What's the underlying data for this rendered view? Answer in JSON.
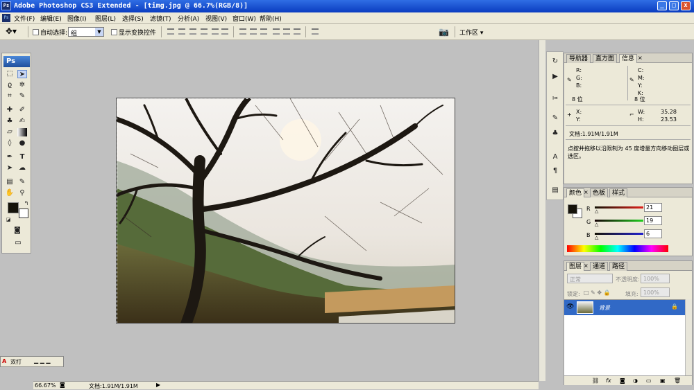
{
  "window": {
    "app_icon": "Ps",
    "title": "Adobe Photoshop CS3 Extended - [timg.jpg @ 66.7%(RGB/8)]",
    "minimize": "_",
    "maximize": "□",
    "close": "x"
  },
  "menu": {
    "items": [
      "文件(F)",
      "编辑(E)",
      "图像(I)",
      "图层(L)",
      "选择(S)",
      "滤镜(T)",
      "分析(A)",
      "视图(V)",
      "窗口(W)",
      "帮助(H)"
    ]
  },
  "options": {
    "auto_select_label": "自动选择:",
    "auto_select_value": "组",
    "show_transform_label": "显示变换控件",
    "workspace_label": "工作区"
  },
  "toolbox": {
    "logo": "Ps"
  },
  "status": {
    "zoom": "66.67%",
    "doc": "文档:1.91M/1.91M"
  },
  "info_panel": {
    "tabs": [
      "导航器",
      "直方图",
      "信息"
    ],
    "rgb": [
      "R:",
      "G:",
      "B:"
    ],
    "cmyk": [
      "C:",
      "M:",
      "Y:",
      "K:"
    ],
    "bit_left": "8 位",
    "bit_right": "8 位",
    "x_label": "X:",
    "y_label": "Y:",
    "w_label": "W:",
    "h_label": "H:",
    "w_value": "35.28",
    "h_value": "23.53",
    "doc": "文档:1.91M/1.91M",
    "hint": "点按并拖移以沿限制为 45 度增量方向移动图层或选区。"
  },
  "color_panel": {
    "tabs": [
      "颜色",
      "色板",
      "样式"
    ],
    "r_label": "R",
    "g_label": "G",
    "b_label": "B",
    "r_value": "21",
    "g_value": "19",
    "b_value": "6",
    "fg_color": "#15130a",
    "bg_color": "#ffffff"
  },
  "layers_panel": {
    "tabs": [
      "图层",
      "通道",
      "路径"
    ],
    "blend_mode": "正常",
    "opacity_label": "不透明度:",
    "opacity_value": "100%",
    "lock_label": "锁定:",
    "fill_label": "填充:",
    "fill_value": "100%",
    "layer_name": "背景",
    "footer_icons": [
      "link-icon",
      "fx-icon",
      "mask-icon",
      "adjustment-icon",
      "group-icon",
      "new-layer-icon",
      "trash-icon"
    ]
  },
  "ime": {
    "label": "双打"
  }
}
